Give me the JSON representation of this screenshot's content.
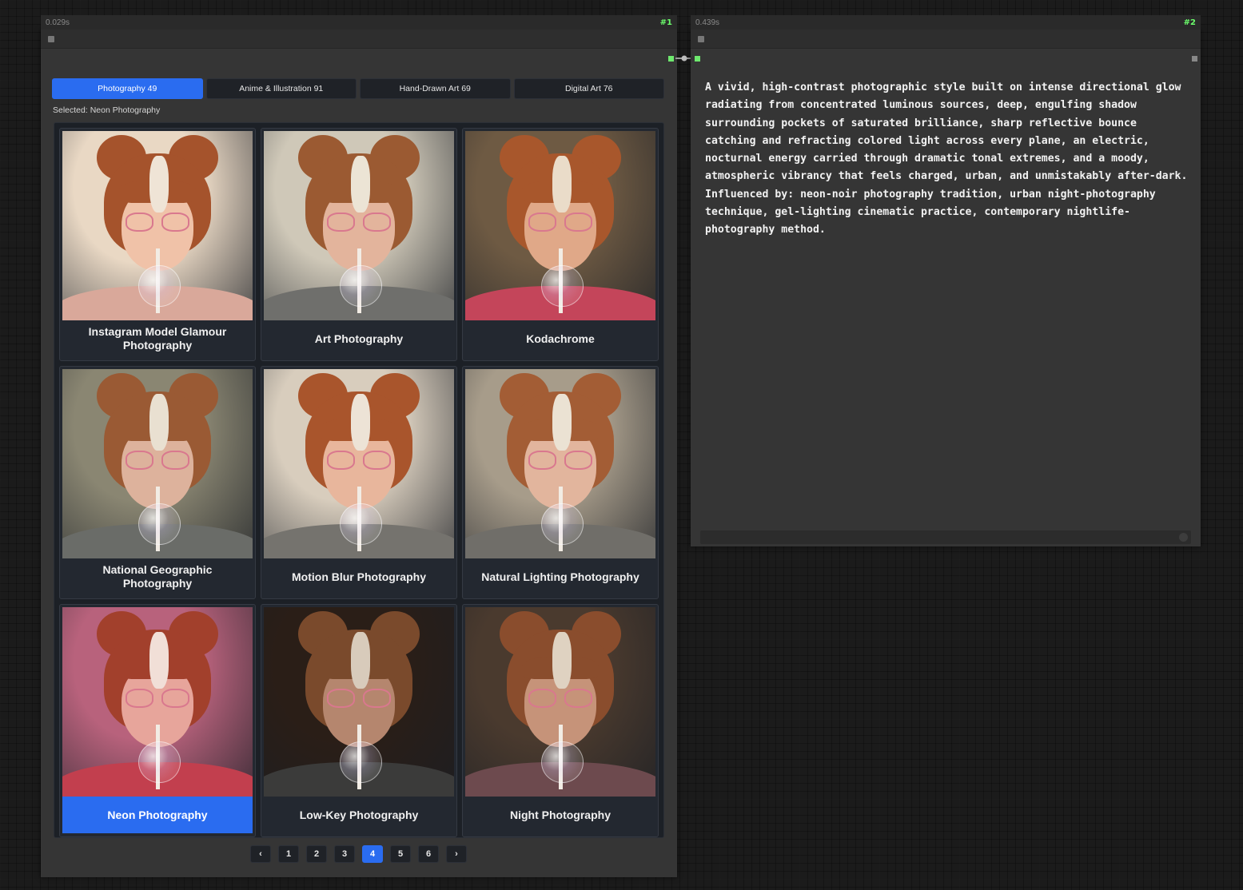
{
  "nodes": {
    "left": {
      "time": "0.029s",
      "id": "#1"
    },
    "right": {
      "time": "0.439s",
      "id": "#2"
    }
  },
  "tabs": [
    {
      "label": "Photography 49",
      "active": true
    },
    {
      "label": "Anime & Illustration 91",
      "active": false
    },
    {
      "label": "Hand-Drawn Art 69",
      "active": false
    },
    {
      "label": "Digital Art 76",
      "active": false
    }
  ],
  "selected_text": "Selected: Neon Photography",
  "cards": [
    {
      "label": "Instagram Model Glamour Photography",
      "selected": false,
      "tone": "glamour"
    },
    {
      "label": "Art Photography",
      "selected": false,
      "tone": "art"
    },
    {
      "label": "Kodachrome",
      "selected": false,
      "tone": "koda"
    },
    {
      "label": "National Geographic Photography",
      "selected": false,
      "tone": "natgeo"
    },
    {
      "label": "Motion Blur Photography",
      "selected": false,
      "tone": "motion"
    },
    {
      "label": "Natural Lighting Photography",
      "selected": false,
      "tone": "natural"
    },
    {
      "label": "Neon Photography",
      "selected": true,
      "tone": "neon"
    },
    {
      "label": "Low-Key Photography",
      "selected": false,
      "tone": "lowkey"
    },
    {
      "label": "Night Photography",
      "selected": false,
      "tone": "night"
    }
  ],
  "pagination": {
    "prev": "‹",
    "next": "›",
    "pages": [
      "1",
      "2",
      "3",
      "4",
      "5",
      "6"
    ],
    "current": "4"
  },
  "description": "A vivid, high-contrast photographic style built on intense directional glow radiating from concentrated luminous sources, deep, engulfing shadow surrounding pockets of saturated brilliance, sharp reflective bounce catching and refracting colored light across every plane, an electric, nocturnal energy carried through dramatic tonal extremes, and a moody, atmospheric vibrancy that feels charged, urban, and unmistakably after-dark. Influenced by: neon-noir photography tradition, urban night-photography technique, gel-lighting cinematic practice, contemporary nightlife-photography method.",
  "colors": {
    "accent": "#2a6cf0",
    "slot": "#6ee86e",
    "node_bg": "#353535"
  },
  "tones": {
    "glamour": {
      "bg": "#e9d8c4",
      "hair": "#a5532c",
      "face": "#f0c2a8",
      "streak": "#efe4d6",
      "shirt": "#d9a89a"
    },
    "art": {
      "bg": "#cfc8b8",
      "hair": "#9b5a32",
      "face": "#e3b49c",
      "streak": "#ece4d5",
      "shirt": "#6f6f6c"
    },
    "koda": {
      "bg": "#6e5a43",
      "hair": "#a8572c",
      "face": "#e0a888",
      "streak": "#eadcc9",
      "shirt": "#c4455a"
    },
    "natgeo": {
      "bg": "#8a8672",
      "hair": "#9a5a34",
      "face": "#ddb29c",
      "streak": "#e9e0d1",
      "shirt": "#6a6c68"
    },
    "motion": {
      "bg": "#d8cdbd",
      "hair": "#a9552c",
      "face": "#e8b69c",
      "streak": "#ede3d6",
      "shirt": "#75736e"
    },
    "natural": {
      "bg": "#a79c8a",
      "hair": "#a35d35",
      "face": "#e2b59d",
      "streak": "#ebe2d3",
      "shirt": "#706e69"
    },
    "neon": {
      "bg": "#b8627c",
      "hair": "#a2402c",
      "face": "#e7a59b",
      "streak": "#f1dfd7",
      "shirt": "#c23f4e"
    },
    "lowkey": {
      "bg": "#2a1e17",
      "hair": "#7a4a2c",
      "face": "#b5866e",
      "streak": "#d8cbbb",
      "shirt": "#3b3b3a"
    },
    "night": {
      "bg": "#4a3a2e",
      "hair": "#8a4d2d",
      "face": "#c69379",
      "streak": "#dfd2c1",
      "shirt": "#6d4a4e"
    }
  }
}
